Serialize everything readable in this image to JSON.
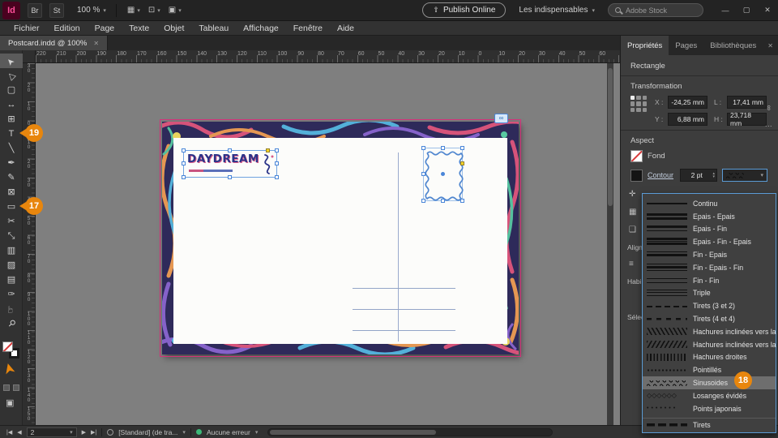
{
  "app_bar": {
    "logo": "Id",
    "bridge": "Br",
    "stock": "St",
    "zoom": "100 %",
    "publish": "Publish Online",
    "workspace": "Les indispensables",
    "search_placeholder": "Adobe Stock"
  },
  "icons": {
    "chevron_down": "▾",
    "chevron_up": "▴",
    "publish_arrow": "⇧",
    "minimize": "—",
    "maximize": "▢",
    "close": "✕",
    "link_chain": "∞",
    "more_options": "…",
    "grid_view": "▦",
    "frame_view": "⊡",
    "screen_mode": "▣",
    "plus_cross": "✛",
    "square_outline": "❑",
    "align_lines": "≡",
    "cursor_arrow": "➤",
    "nav_first": "|◀",
    "nav_prev": "◀",
    "nav_next": "▶",
    "nav_last": "▶|"
  },
  "menu": {
    "items": [
      {
        "name": "menu-fichier",
        "label": "Fichier"
      },
      {
        "name": "menu-edition",
        "label": "Edition"
      },
      {
        "name": "menu-page",
        "label": "Page"
      },
      {
        "name": "menu-texte",
        "label": "Texte"
      },
      {
        "name": "menu-objet",
        "label": "Objet"
      },
      {
        "name": "menu-tableau",
        "label": "Tableau"
      },
      {
        "name": "menu-affichage",
        "label": "Affichage"
      },
      {
        "name": "menu-fenetre",
        "label": "Fenêtre"
      },
      {
        "name": "menu-aide",
        "label": "Aide"
      }
    ]
  },
  "doc_tab": {
    "title": "Postcard.indd @ 100%"
  },
  "ruler_h": {
    "numbers": [
      "220",
      "210",
      "200",
      "190",
      "180",
      "170",
      "160",
      "150",
      "140",
      "130",
      "120",
      "110",
      "100",
      "90",
      "80",
      "70",
      "60",
      "50",
      "40",
      "30",
      "20",
      "10",
      "0",
      "10",
      "20",
      "30",
      "40",
      "50",
      "60"
    ]
  },
  "ruler_v": {
    "numbers": [
      "30",
      "20",
      "10",
      "0",
      "10",
      "20",
      "30",
      "40",
      "50",
      "60",
      "70",
      "80",
      "90",
      "100",
      "110",
      "120",
      "130",
      "140",
      "150"
    ]
  },
  "toolbar": {
    "tools": [
      {
        "name": "selection-tool",
        "glyph": "➤",
        "icon_cls": "rotcursor",
        "row_cls": "active"
      },
      {
        "name": "direct-selection-tool",
        "glyph": "▷",
        "icon_cls": "rotcursor"
      },
      {
        "name": "page-tool",
        "glyph": "▢"
      },
      {
        "name": "gap-tool",
        "glyph": "↔"
      },
      {
        "name": "content-collector-tool",
        "glyph": "⊞"
      },
      {
        "name": "type-tool",
        "glyph": "T"
      },
      {
        "name": "line-tool",
        "glyph": "╲"
      },
      {
        "name": "pen-tool",
        "glyph": "✒"
      },
      {
        "name": "pencil-tool",
        "glyph": "✎"
      },
      {
        "name": "rectangle-frame-tool",
        "glyph": "⊠"
      },
      {
        "name": "rectangle-tool",
        "glyph": "▭"
      },
      {
        "name": "scissors-tool",
        "glyph": "✂"
      },
      {
        "name": "free-transform-tool",
        "glyph": "⤡"
      },
      {
        "name": "gradient-swatch-tool",
        "glyph": "▥"
      },
      {
        "name": "gradient-feather-tool",
        "glyph": "▨"
      },
      {
        "name": "note-tool",
        "glyph": "▤"
      },
      {
        "name": "eyedropper-tool",
        "glyph": "✑"
      },
      {
        "name": "hand-tool",
        "glyph": "☞",
        "icon_cls": "rot270"
      },
      {
        "name": "zoom-tool",
        "glyph": "⚲",
        "icon_cls": "rot45"
      }
    ]
  },
  "postcard": {
    "logo": "DAYDREAM"
  },
  "panel": {
    "tabs": [
      {
        "name": "tab-proprietes",
        "label": "Propriétés",
        "row_cls": "active"
      },
      {
        "name": "tab-pages",
        "label": "Pages"
      },
      {
        "name": "tab-bibliotheques",
        "label": "Bibliothèques"
      }
    ],
    "object_type": "Rectangle",
    "transform_heading": "Transformation",
    "fields": {
      "x_label": "X :",
      "x_value": "-24,25 mm",
      "w_label": "L :",
      "w_value": "17,41 mm",
      "y_label": "Y :",
      "y_value": "6,88 mm",
      "h_label": "H :",
      "h_value": "23,718 mm"
    },
    "aspect_heading": "Aspect",
    "fill_label": "Fond",
    "stroke_label": "Contour",
    "stroke_weight": "2 pt",
    "side_sections": [
      {
        "label": "Aligne"
      },
      {
        "label": "Habill"
      },
      {
        "label": "Sélect"
      }
    ],
    "stroke_styles": [
      {
        "label": "Continu",
        "cls": "pv-solid"
      },
      {
        "label": "Epais - Epais",
        "cls": "pv-thick-thick"
      },
      {
        "label": "Epais - Fin",
        "cls": "pv-thick-thin"
      },
      {
        "label": "Epais - Fin - Epais",
        "cls": "pv-thick-thin-thick"
      },
      {
        "label": "Fin - Epais",
        "cls": "pv-thin-thick"
      },
      {
        "label": "Fin - Epais - Fin",
        "cls": "pv-thin-thick-thin"
      },
      {
        "label": "Fin - Fin",
        "cls": "pv-thin-thin"
      },
      {
        "label": "Triple",
        "cls": "pv-triple"
      },
      {
        "label": "Tirets (3 et 2)",
        "cls": "pv-dash32"
      },
      {
        "label": "Tirets (4 et 4)",
        "cls": "pv-dash44"
      },
      {
        "label": "Hachures inclinées vers la gauche",
        "cls": "pv-hatch-left"
      },
      {
        "label": "Hachures inclinées vers la droite",
        "cls": "pv-hatch-right"
      },
      {
        "label": "Hachures droites",
        "cls": "pv-hatch-straight"
      },
      {
        "label": "Pointillés",
        "cls": "pv-dots"
      },
      {
        "label": "Sinusoides",
        "cls": "pv-wave",
        "row_cls": "selected"
      },
      {
        "label": "Losanges évidés",
        "cls": "pv-diamonds",
        "glyphs": "◇◇◇◇◇◇"
      },
      {
        "label": "Points japonais",
        "cls": "pv-jdots",
        "glyphs": "•••••••"
      },
      {
        "label": "Tirets",
        "cls": "pv-dash-heavy",
        "row_cls": "section-row"
      }
    ]
  },
  "callouts": {
    "type_tool": "19",
    "rectangle_tool": "17",
    "sinusoides": "18"
  },
  "status_bar": {
    "page": "2",
    "preset": "[Standard] (de tra...",
    "errors": "Aucune erreur"
  },
  "colors": {
    "accent_orange": "#e8860d",
    "selection_blue": "#4a86d8",
    "postcard_navy": "#2e2a5a",
    "bleed_pink": "#d4327a",
    "error_ok_green": "#3cb878"
  }
}
